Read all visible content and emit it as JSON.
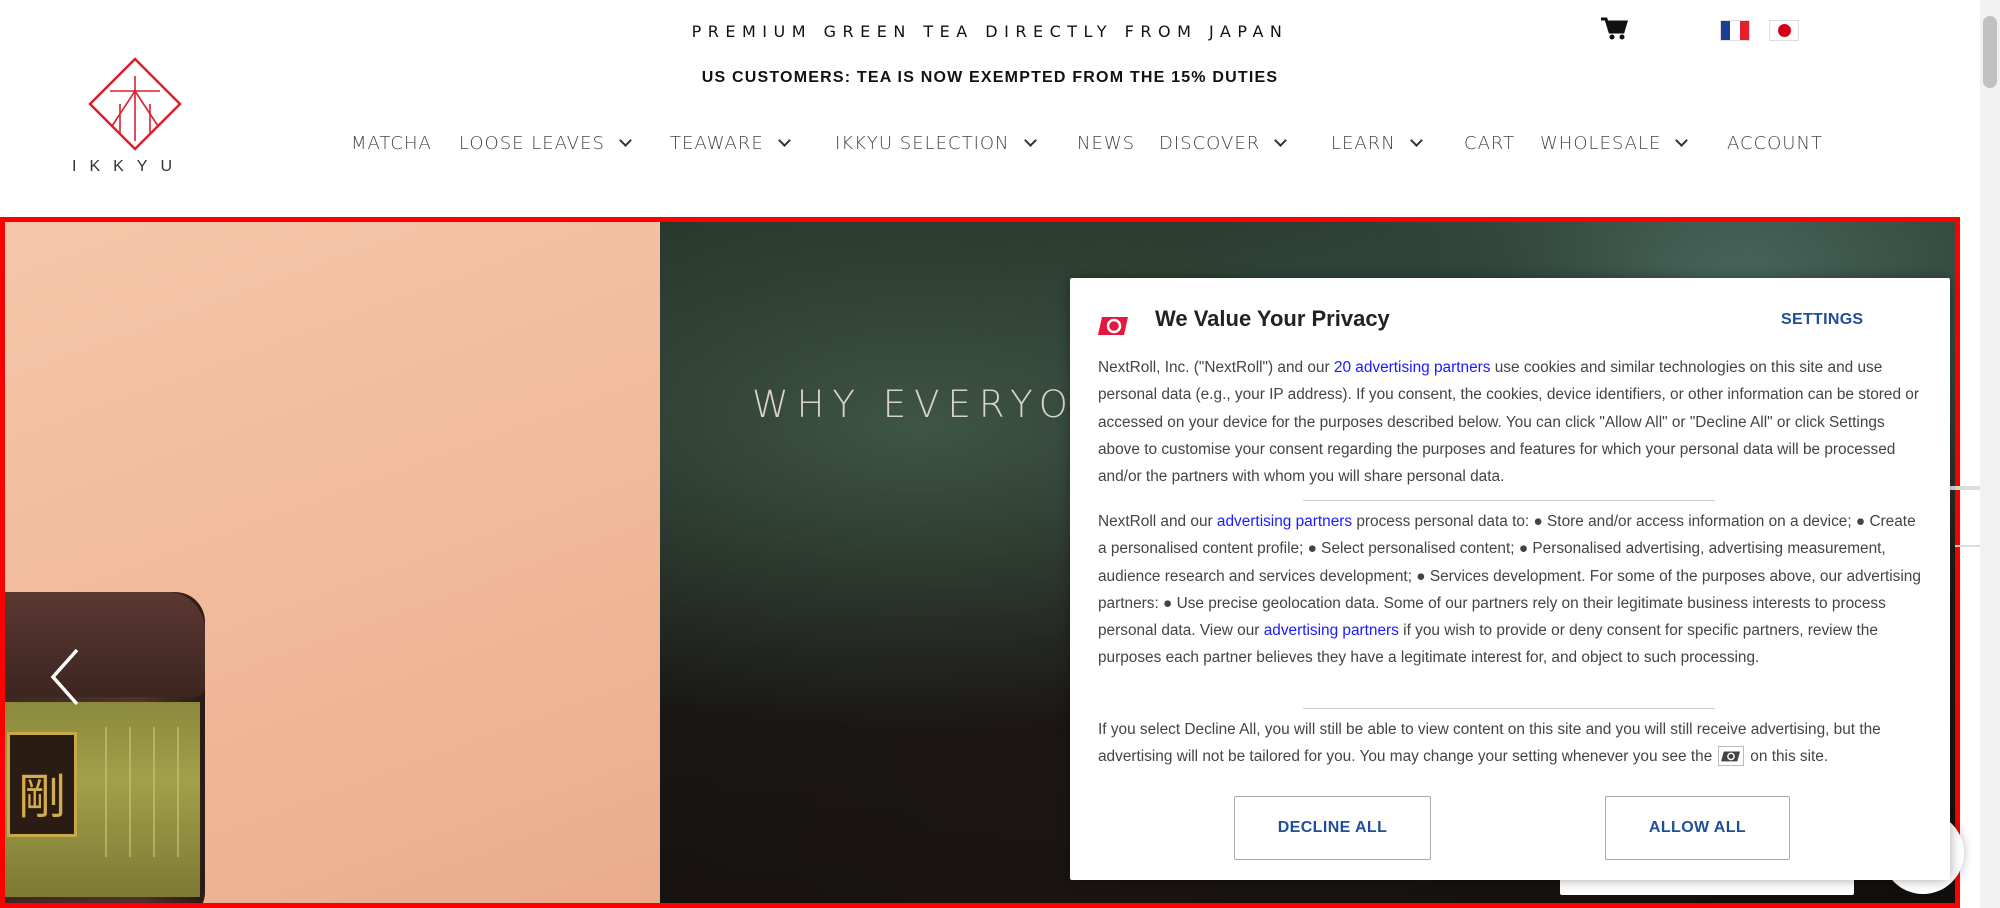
{
  "header": {
    "tagline": "PREMIUM GREEN TEA DIRECTLY FROM JAPAN",
    "notice": "US CUSTOMERS: TEA IS NOW EXEMPTED FROM THE 15% DUTIES",
    "logo_text": "IKKYU",
    "icons": {
      "cart": "cart-icon",
      "flag_fr": "flag-france-icon",
      "flag_jp": "flag-japan-icon"
    }
  },
  "nav": {
    "items": [
      {
        "label": "MATCHA"
      },
      {
        "label": "LOOSE LEAVES"
      },
      {
        "label": "TEAWARE"
      },
      {
        "label": "IKKYU SELECTION"
      },
      {
        "label": "NEWS"
      },
      {
        "label": "DISCOVER"
      },
      {
        "label": "LEARN"
      },
      {
        "label": "CART"
      },
      {
        "label": "WHOLESALE"
      },
      {
        "label": "ACCOUNT"
      }
    ]
  },
  "hero": {
    "title": "WHY EVERYO"
  },
  "consent": {
    "title": "We Value Your Privacy",
    "settings_label": "SETTINGS",
    "p1_a": "NextRoll, Inc. (\"NextRoll\") and our ",
    "p1_link": "20 advertising partners",
    "p1_b": " use cookies and similar technologies on this site and use personal data (e.g., your IP address). If you consent, the cookies, device identifiers, or other information can be stored or accessed on your device for the purposes described below. You can click \"Allow All\" or \"Decline All\" or click Settings above to customise your consent regarding the purposes and features for which your personal data will be processed and/or the partners with whom you will share personal data.",
    "p2_a": "NextRoll and our ",
    "p2_link1": "advertising partners",
    "p2_b": " process personal data to: ● Store and/or access information on a device; ● Create a personalised content profile; ● Select personalised content; ● Personalised advertising, advertising measurement, audience research and services development; ● Services development. For some of the purposes above, our advertising partners: ● Use precise geolocation data. Some of our partners rely on their legitimate business interests to process personal data. View our ",
    "p2_link2": "advertising partners",
    "p2_c": " if you wish to provide or deny consent for specific partners, review the purposes each partner believes they have a legitimate interest for, and object to such processing.",
    "p3_a": "If you select Decline All, you will still be able to view content on this site and you will still receive advertising, but the advertising will not be tailored for you. You may change your setting whenever you see the",
    "p3_b": "on this site.",
    "decline_label": "DECLINE ALL",
    "allow_label": "ALLOW ALL",
    "brand_color": "#e5173f",
    "button_text_color": "#1f4e9b"
  }
}
